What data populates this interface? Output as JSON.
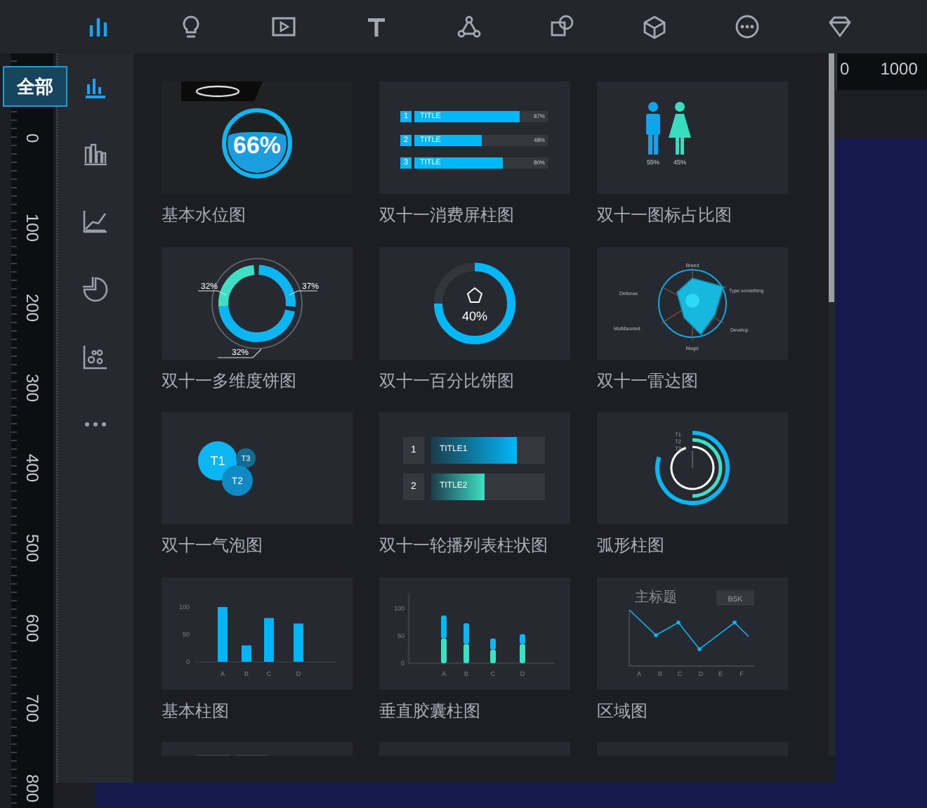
{
  "toolbar": [
    {
      "kind": "bar-chart",
      "selected": true
    },
    {
      "kind": "bulb",
      "selected": false
    },
    {
      "kind": "play",
      "selected": false
    },
    {
      "kind": "text",
      "selected": false
    },
    {
      "kind": "nodes",
      "selected": false
    },
    {
      "kind": "shapes",
      "selected": false
    },
    {
      "kind": "cube",
      "selected": false
    },
    {
      "kind": "more",
      "selected": false
    },
    {
      "kind": "diamond",
      "selected": false
    }
  ],
  "vertical_ruler": [
    "0",
    "100",
    "200",
    "300",
    "400",
    "500",
    "600",
    "700",
    "800"
  ],
  "horizontal_ruler": [
    "0",
    "1000"
  ],
  "categories": [
    {
      "kind": "all",
      "selected": true,
      "tooltip": "全部"
    },
    {
      "kind": "bar",
      "selected": false
    },
    {
      "kind": "line",
      "selected": false
    },
    {
      "kind": "pie",
      "selected": false
    },
    {
      "kind": "scatter",
      "selected": false
    },
    {
      "kind": "more",
      "selected": false
    }
  ],
  "cards": [
    {
      "kind": "water",
      "label": "基本水位图",
      "reading": "66%"
    },
    {
      "kind": "bar-list",
      "label": "双十一消费屏柱图",
      "rows": [
        {
          "index": "1",
          "title": "TITLE",
          "reading": "87%",
          "level": 0.79
        },
        {
          "index": "2",
          "title": "TITLE",
          "reading": "48%",
          "level": 0.5
        },
        {
          "index": "3",
          "title": "TITLE",
          "reading": "80%",
          "level": 0.66
        }
      ]
    },
    {
      "kind": "person-ratio",
      "label": "双十一图标占比图",
      "people": [
        {
          "reading": "55%",
          "color": "#0ea6ea"
        },
        {
          "reading": "45%",
          "color": "#38dcbf"
        }
      ]
    },
    {
      "kind": "multi-donut",
      "label": "双十一多维度饼图",
      "readings": [
        "32%",
        "37%",
        "32%"
      ]
    },
    {
      "kind": "percent-ring",
      "label": "双十一百分比饼图",
      "reading": "40%"
    },
    {
      "kind": "radar",
      "label": "双十一雷达图",
      "axes": [
        "Breed",
        "Defense",
        "Type something",
        "Multifaceted",
        "Develop",
        "Magic"
      ]
    },
    {
      "kind": "bubble",
      "label": "双十一气泡图",
      "bubbles": [
        "T1",
        "T3",
        "T2"
      ]
    },
    {
      "kind": "carousel-bars",
      "label": "双十一轮播列表柱状图",
      "rows": [
        {
          "index": "1",
          "title": "TITLE1",
          "level": 0.75
        },
        {
          "index": "2",
          "title": "TITLE2",
          "level": 0.47
        }
      ]
    },
    {
      "kind": "arc-bars",
      "label": "弧形柱图",
      "rings": [
        {
          "name": "T1"
        },
        {
          "name": "T2"
        },
        {
          "name": "T3"
        }
      ]
    },
    {
      "kind": "bar",
      "label": "基本柱图",
      "chart_data": {
        "type": "bar",
        "categories": [
          "A",
          "B",
          "C",
          "D"
        ],
        "ylim": [
          0,
          100
        ],
        "yticks": [
          0,
          50,
          100
        ],
        "series": [
          {
            "color": "#00b4f8",
            "values": [
              100,
              30,
              80,
              70
            ]
          }
        ]
      }
    },
    {
      "kind": "capsule",
      "label": "垂直胶囊柱图",
      "chart_data": {
        "type": "bar",
        "stacked": true,
        "categories": [
          "A",
          "B",
          "C",
          "D"
        ],
        "ylim": [
          0,
          128
        ],
        "yticks": [
          0,
          50,
          100
        ],
        "series": [
          {
            "color": "#3de0c4",
            "values": [
              45,
              35,
              25,
              35
            ]
          },
          {
            "color": "#0bb6f2",
            "values": [
              42,
              38,
              20,
              18
            ]
          }
        ]
      }
    },
    {
      "kind": "line",
      "label": "区域图",
      "title": "主标题",
      "badge": "B5K",
      "categories": [
        "A",
        "B",
        "C",
        "D",
        "E",
        "F"
      ]
    },
    {
      "kind": "partial-tabs"
    },
    {
      "kind": "partial"
    },
    {
      "kind": "partial"
    }
  ]
}
